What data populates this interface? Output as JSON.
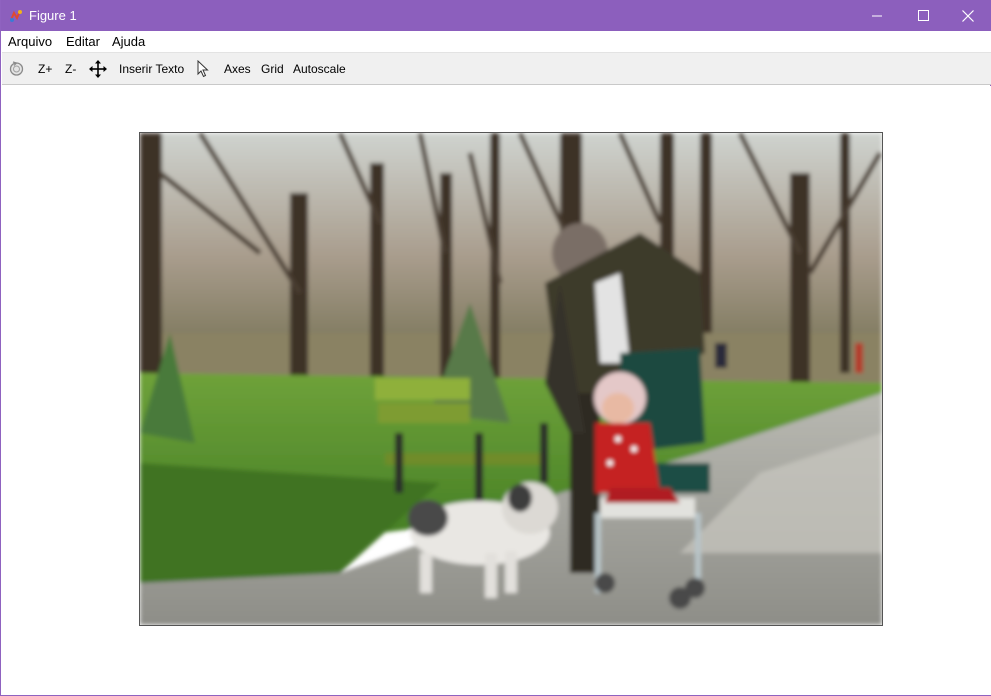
{
  "window": {
    "title": "Figure 1",
    "controls": {
      "minimize": "minimize",
      "maximize": "maximize",
      "close": "close"
    }
  },
  "menu": {
    "items": [
      {
        "label": "Arquivo"
      },
      {
        "label": "Editar"
      },
      {
        "label": "Ajuda"
      }
    ]
  },
  "toolbar": {
    "zoom_in": "Z+",
    "zoom_out": "Z-",
    "insert_text": "Inserir Texto",
    "axes": "Axes",
    "grid": "Grid",
    "autoscale": "Autoscale",
    "icons": [
      "rotate-icon",
      "pan-move-icon",
      "pointer-cursor-icon"
    ]
  },
  "figure": {
    "image_subject": "park-photo"
  },
  "colors": {
    "titlebar": "#8c5fbd",
    "toolbar": "#f0f0f0"
  }
}
